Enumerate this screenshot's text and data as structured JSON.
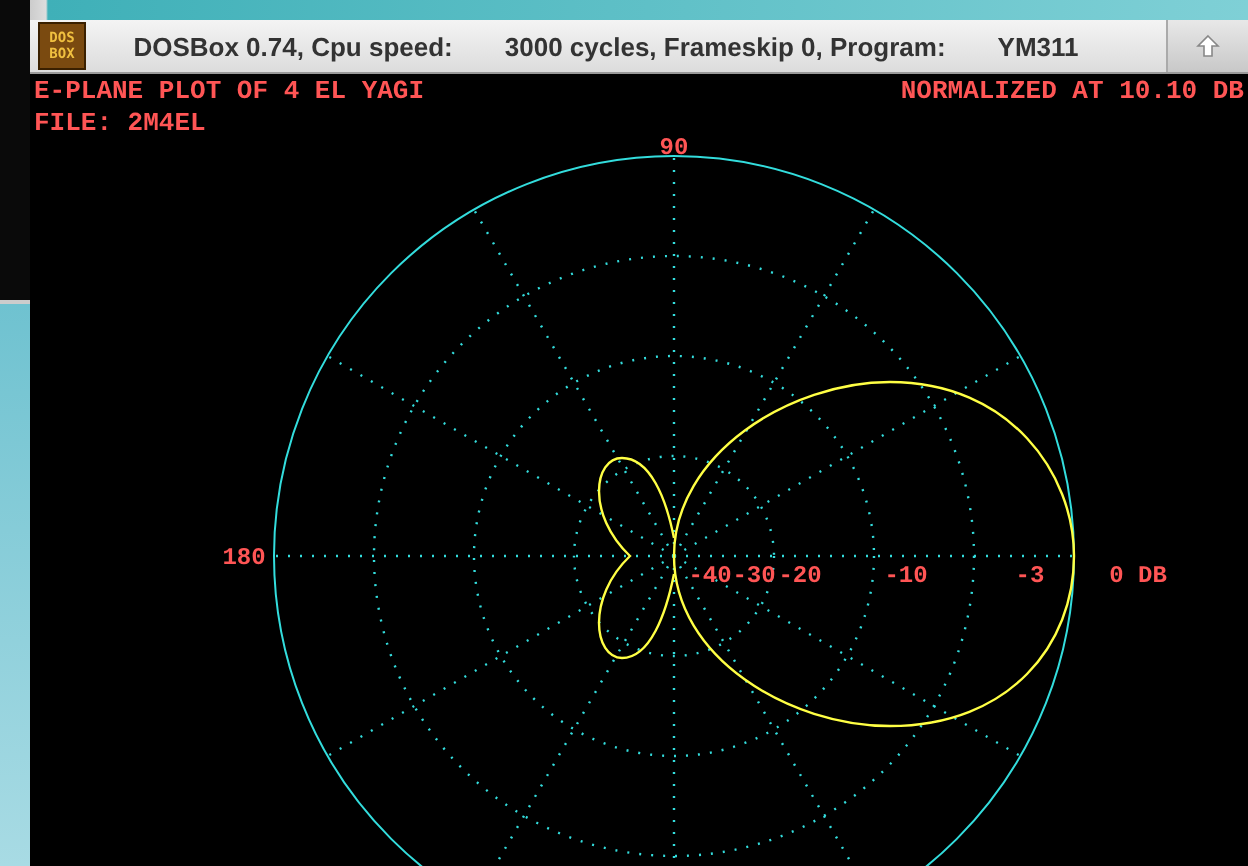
{
  "window": {
    "title_parts": [
      "DOSBox 0.74, Cpu speed:",
      "3000 cycles, Frameskip  0, Program:",
      "YM311"
    ],
    "icon_lines": [
      "DOS",
      "BOX"
    ]
  },
  "plot": {
    "header_left": "E-PLANE PLOT OF 4 EL YAGI",
    "header_right": "NORMALIZED AT 10.10 DB",
    "file_line": "FILE: 2M4EL",
    "angle_labels": [
      {
        "text": "90",
        "kind": "top"
      },
      {
        "text": "180",
        "kind": "left"
      }
    ],
    "db_labels": [
      "-40",
      "-30",
      "-20",
      "-10",
      "-3",
      "0 DB"
    ]
  }
}
